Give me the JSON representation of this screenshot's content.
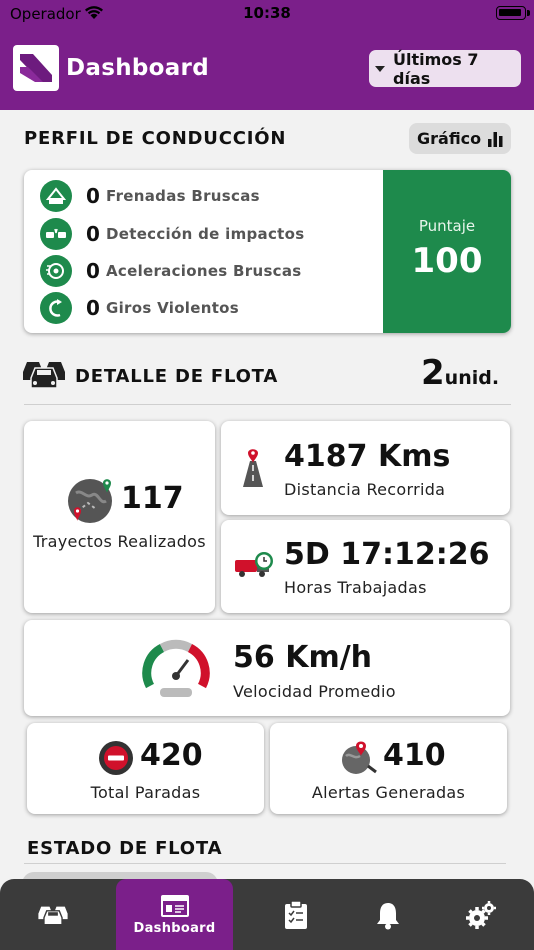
{
  "status_bar": {
    "carrier": "Operador",
    "time": "10:38"
  },
  "header": {
    "title": "Dashboard",
    "period": "Últimos 7 días"
  },
  "driving_profile": {
    "title": "PERFIL DE CONDUCCIÓN",
    "graph_button": "Gráfico",
    "items": [
      {
        "count": "0",
        "label": "Frenadas Bruscas",
        "icon": "hard-braking-icon"
      },
      {
        "count": "0",
        "label": "Detección de impactos",
        "icon": "impact-detection-icon"
      },
      {
        "count": "0",
        "label": "Aceleraciones Bruscas",
        "icon": "hard-acceleration-icon"
      },
      {
        "count": "0",
        "label": "Giros Violentos",
        "icon": "sharp-turn-icon"
      }
    ],
    "score_label": "Puntaje",
    "score_value": "100",
    "score_color": "#1e8a4c"
  },
  "fleet_detail": {
    "title": "DETALLE DE FLOTA",
    "units_count": "2",
    "units_suffix": "unid.",
    "trips": {
      "value": "117",
      "label": "Trayectos Realizados"
    },
    "distance": {
      "value": "4187 Kms",
      "label": "Distancia Recorrida"
    },
    "hours": {
      "value": "5D 17:12:26",
      "label": "Horas Trabajadas"
    },
    "speed": {
      "value": "56 Km/h",
      "label": "Velocidad Promedio"
    },
    "stops": {
      "value": "420",
      "label": "Total Paradas"
    },
    "alerts": {
      "value": "410",
      "label": "Alertas Generadas"
    }
  },
  "fleet_status": {
    "title": "ESTADO DE FLOTA"
  },
  "tabbar": {
    "active_label": "Dashboard",
    "tabs": [
      "fleet-icon",
      "dashboard-icon",
      "checklist-icon",
      "bell-icon",
      "settings-icon"
    ]
  },
  "colors": {
    "brand_purple": "#7b1f8a",
    "green": "#1e8a4c",
    "red": "#d0112b",
    "tabbar": "#3b3b3b"
  }
}
